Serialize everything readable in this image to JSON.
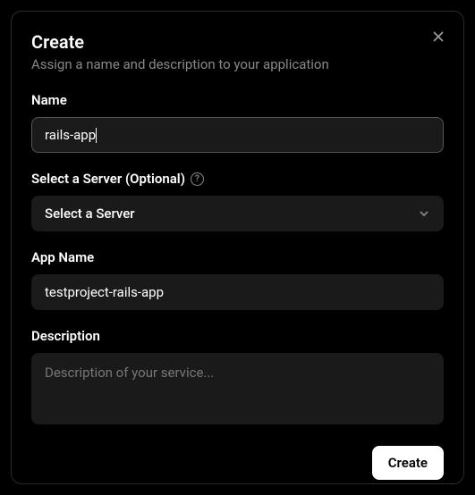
{
  "header": {
    "title": "Create",
    "subtitle": "Assign a name and description to your application"
  },
  "fields": {
    "name": {
      "label": "Name",
      "value": "rails-app"
    },
    "server": {
      "label": "Select a Server (Optional)",
      "selected": "Select a Server"
    },
    "appName": {
      "label": "App Name",
      "value": "testproject-rails-app"
    },
    "description": {
      "label": "Description",
      "placeholder": "Description of your service...",
      "value": ""
    }
  },
  "footer": {
    "submit": "Create"
  }
}
